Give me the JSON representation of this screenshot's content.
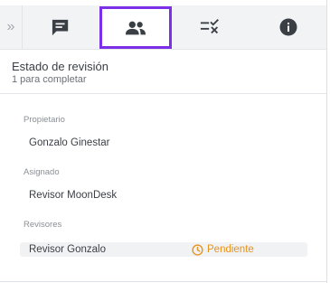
{
  "tabs": [
    {
      "id": "comments",
      "icon": "comments-icon",
      "active": false
    },
    {
      "id": "reviewers",
      "icon": "people-icon",
      "active": true
    },
    {
      "id": "checklist",
      "icon": "checklist-icon",
      "active": false
    },
    {
      "id": "info",
      "icon": "info-icon",
      "active": false
    }
  ],
  "collapse_glyph": "»",
  "review": {
    "title": "Estado de revisión",
    "subtitle": "1 para completar"
  },
  "owner": {
    "label": "Propietario",
    "value": "Gonzalo Ginestar"
  },
  "assigned": {
    "label": "Asignado",
    "value": "Revisor MoonDesk"
  },
  "reviewers": {
    "label": "Revisores",
    "items": [
      {
        "name": "Revisor Gonzalo",
        "status": "Pendiente",
        "status_color": "#e8921e"
      }
    ]
  },
  "colors": {
    "accent": "#7b2fe6",
    "icon": "#3a3f45",
    "pending": "#e8921e"
  }
}
